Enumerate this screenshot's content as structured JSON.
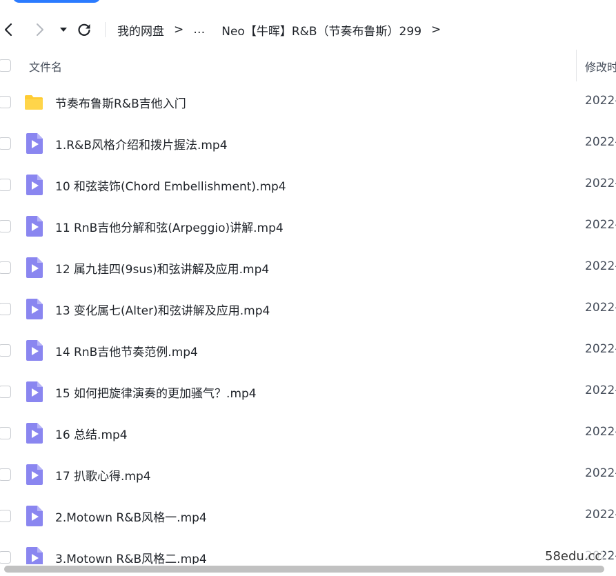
{
  "toolbar": {
    "back_icon": "chevron-left-icon",
    "forward_icon": "chevron-right-icon",
    "history_icon": "caret-down-icon",
    "refresh_icon": "refresh-icon"
  },
  "breadcrumb": {
    "items": [
      "我的网盘",
      "…",
      "Neo【牛晖】R&B（节奏布鲁斯）299"
    ],
    "separator": ">"
  },
  "table": {
    "col_name": "文件名",
    "col_modified": "修改时",
    "rows": [
      {
        "type": "folder",
        "icon": "folder-icon",
        "name": "节奏布鲁斯R&B吉他入门",
        "date": "2022-"
      },
      {
        "type": "video",
        "icon": "video-file-icon",
        "name": "1.R&B风格介绍和拨片握法.mp4",
        "date": "2022-"
      },
      {
        "type": "video",
        "icon": "video-file-icon",
        "name": "10 和弦装饰(Chord Embellishment).mp4",
        "date": "2022-"
      },
      {
        "type": "video",
        "icon": "video-file-icon",
        "name": "11 RnB吉他分解和弦(Arpeggio)讲解.mp4",
        "date": "2022-"
      },
      {
        "type": "video",
        "icon": "video-file-icon",
        "name": "12 属九挂四(9sus)和弦讲解及应用.mp4",
        "date": "2022-"
      },
      {
        "type": "video",
        "icon": "video-file-icon",
        "name": "13 变化属七(Alter)和弦讲解及应用.mp4",
        "date": "2022-"
      },
      {
        "type": "video",
        "icon": "video-file-icon",
        "name": "14 RnB吉他节奏范例.mp4",
        "date": "2022-"
      },
      {
        "type": "video",
        "icon": "video-file-icon",
        "name": "15 如何把旋律演奏的更加骚气？.mp4",
        "date": "2022-"
      },
      {
        "type": "video",
        "icon": "video-file-icon",
        "name": "16 总结.mp4",
        "date": "2022-"
      },
      {
        "type": "video",
        "icon": "video-file-icon",
        "name": "17 扒歌心得.mp4",
        "date": "2022-"
      },
      {
        "type": "video",
        "icon": "video-file-icon",
        "name": "2.Motown R&B风格一.mp4",
        "date": "2022-"
      },
      {
        "type": "video",
        "icon": "video-file-icon",
        "name": "3.Motown R&B风格二.mp4",
        "date": "2022-"
      }
    ]
  },
  "watermark": "58edu.cc",
  "colors": {
    "accent": "#2b7bff",
    "folder": "#ffcc33",
    "video": "#8a86f0"
  }
}
